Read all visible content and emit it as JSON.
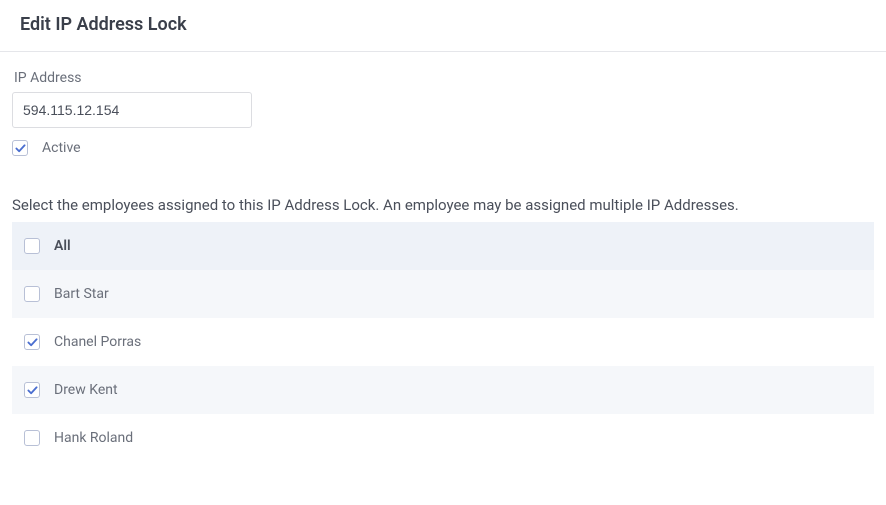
{
  "header": {
    "title": "Edit IP Address Lock"
  },
  "form": {
    "ip_label": "IP Address",
    "ip_value": "594.115.12.154",
    "active_label": "Active",
    "active_checked": true
  },
  "instruction": "Select the employees assigned to this IP Address Lock. An employee may be assigned multiple IP Addresses.",
  "employee_list": {
    "all_label": "All",
    "all_checked": false,
    "items": [
      {
        "name": "Bart Star",
        "checked": false
      },
      {
        "name": "Chanel Porras",
        "checked": true
      },
      {
        "name": "Drew Kent",
        "checked": true
      },
      {
        "name": "Hank Roland",
        "checked": false
      }
    ]
  }
}
